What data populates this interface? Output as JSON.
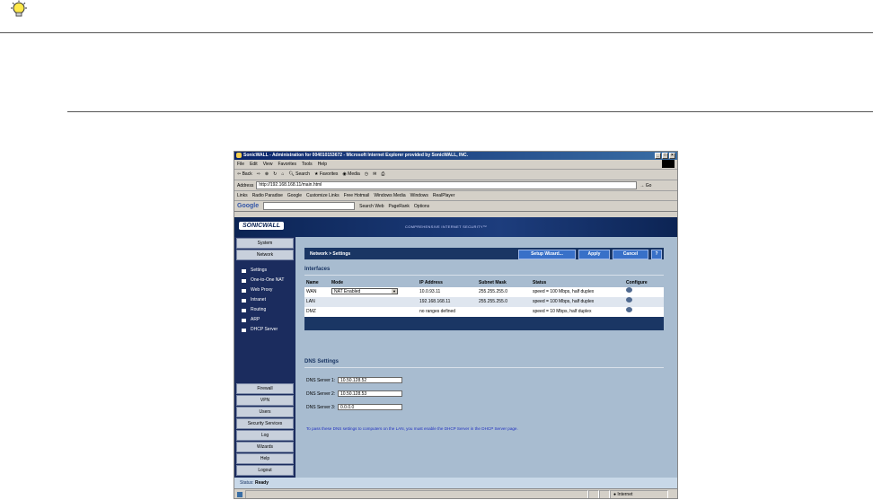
{
  "browser": {
    "title": "SonicWALL - Administration for 004010153672 - Microsoft Internet Explorer provided by SonicWALL, INC.",
    "menu": [
      "File",
      "Edit",
      "View",
      "Favorites",
      "Tools",
      "Help"
    ],
    "toolbar": [
      "Back",
      "Search",
      "Favorites",
      "Media"
    ],
    "address_label": "Address",
    "address": "http://192.168.168.11/main.html",
    "go_label": "Go",
    "links_label": "Links",
    "links": [
      "Radio Paradise",
      "Google",
      "Customize Links",
      "Free Hotmail",
      "Windows Media",
      "Windows",
      "RealPlayer"
    ],
    "google_label": "Google",
    "google_items": [
      "Search Web",
      "PageRank",
      "Options"
    ],
    "status_zone": "Internet"
  },
  "app": {
    "logo": "SONICWALL",
    "tagline": "COMPREHENSIVE INTERNET SECURITY™",
    "nav_top": [
      "System",
      "Network"
    ],
    "subnav": [
      "Settings",
      "One-to-One NAT",
      "Web Proxy",
      "Intranet",
      "Routing",
      "ARP",
      "DHCP Server"
    ],
    "nav_bottom": [
      "Firewall",
      "VPN",
      "Users",
      "Security Services",
      "Log",
      "Wizards",
      "Help",
      "Logout"
    ],
    "panel_title": "Network > Settings",
    "buttons": {
      "wizard": "Setup Wizard...",
      "apply": "Apply",
      "cancel": "Cancel",
      "help": "?"
    },
    "interfaces": {
      "title": "Interfaces",
      "headers": [
        "Name",
        "Mode",
        "IP Address",
        "Subnet Mask",
        "Status",
        "Configure"
      ],
      "rows": [
        {
          "name": "WAN",
          "mode": "NAT Enabled",
          "ip": "10.0.93.11",
          "mask": "255.255.255.0",
          "status": "speed = 100 Mbps, half duplex"
        },
        {
          "name": "LAN",
          "mode": "",
          "ip": "192.168.168.11",
          "mask": "255.255.255.0",
          "status": "speed = 100 Mbps, half duplex"
        },
        {
          "name": "DMZ",
          "mode": "",
          "ip": "no ranges defined",
          "mask": "",
          "status": "speed = 10 Mbps, half duplex"
        }
      ]
    },
    "dns": {
      "title": "DNS Settings",
      "servers": [
        {
          "label": "DNS Server 1:",
          "value": "10.50.128.52"
        },
        {
          "label": "DNS Server 2:",
          "value": "10.50.128.53"
        },
        {
          "label": "DNS Server 3:",
          "value": "0.0.0.0"
        }
      ],
      "note": "To pass these DNS settings to computers on the LAN, you must enable the DHCP Server in the DHCP Server page."
    },
    "status_label": "Status:",
    "status_value": "Ready"
  }
}
